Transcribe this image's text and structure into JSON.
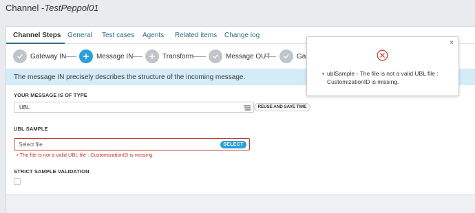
{
  "header": {
    "title_prefix": "Channel -",
    "channel_name": "TestPeppol01"
  },
  "tabs": [
    {
      "label": "Channel Steps",
      "active": true
    },
    {
      "label": "General"
    },
    {
      "label": "Test cases"
    },
    {
      "label": "Agents"
    },
    {
      "label": "Related items"
    },
    {
      "label": "Change log"
    }
  ],
  "steps": [
    {
      "label": "Gateway IN",
      "icon": "check-icon",
      "state": "done"
    },
    {
      "label": "Message IN",
      "icon": "plus-icon",
      "state": "current"
    },
    {
      "label": "Transform",
      "icon": "plus-icon",
      "state": "todo"
    },
    {
      "label": "Message OUT",
      "icon": "check-icon",
      "state": "done"
    },
    {
      "label": "Gate",
      "icon": "check-icon",
      "state": "done"
    }
  ],
  "info": {
    "text": "The message IN precisely describes the structure of the incoming message."
  },
  "message_type": {
    "label": "YOUR MESSAGE IS OF TYPE",
    "value": "UBL",
    "reuse_button": "REUSE AND SAVE TIME"
  },
  "ubl_sample": {
    "label": "UBL SAMPLE",
    "placeholder": "Select file",
    "select_button": "SELECT",
    "error": "The file is not a valid UBL file : CustomizationID is missing."
  },
  "strict_validation": {
    "label": "STRICT SAMPLE VALIDATION",
    "checked": false
  },
  "popup": {
    "close": "×",
    "bullet": "•",
    "message": "ublSample - The file is not a valid UBL file : CustomizationID is missing."
  },
  "colors": {
    "accent": "#2a9fd8",
    "link": "#2d6e86",
    "error": "#c0392b",
    "info_bg": "#d3ecf8",
    "step_done": "#c1c5cb"
  }
}
